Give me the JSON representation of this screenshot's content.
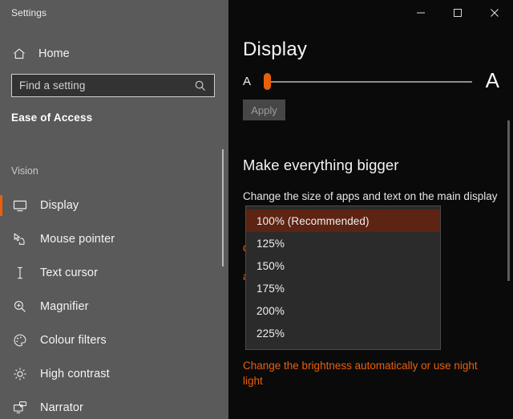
{
  "window": {
    "app_title": "Settings",
    "caption": {
      "minimize": "minimize-icon",
      "maximize": "maximize-icon",
      "close": "close-icon"
    }
  },
  "sidebar": {
    "home_label": "Home",
    "home_icon": "home-icon",
    "search": {
      "placeholder": "Find a setting",
      "value": "",
      "icon": "search-icon"
    },
    "section_title": "Ease of Access",
    "group_header": "Vision",
    "items": [
      {
        "label": "Display",
        "icon": "monitor-icon",
        "selected": true
      },
      {
        "label": "Mouse pointer",
        "icon": "pointer-hand-icon",
        "selected": false
      },
      {
        "label": "Text cursor",
        "icon": "text-cursor-icon",
        "selected": false
      },
      {
        "label": "Magnifier",
        "icon": "magnifier-plus-icon",
        "selected": false
      },
      {
        "label": "Colour filters",
        "icon": "palette-icon",
        "selected": false
      },
      {
        "label": "High contrast",
        "icon": "brightness-icon",
        "selected": false
      },
      {
        "label": "Narrator",
        "icon": "narrator-icon",
        "selected": false
      }
    ]
  },
  "main": {
    "page_title": "Display",
    "text_size_slider": {
      "small_label": "A",
      "large_label": "A",
      "value_percent": 3
    },
    "apply_label": "Apply",
    "bigger_heading": "Make everything bigger",
    "bigger_label": "Change the size of apps and text on the main display",
    "occluded_links": [
      "displays",
      "and mouse"
    ],
    "bottom_link": "Change the brightness automatically or use night light"
  },
  "dropdown": {
    "open": true,
    "selected": "100% (Recommended)",
    "options": [
      "100% (Recommended)",
      "125%",
      "150%",
      "175%",
      "200%",
      "225%"
    ]
  },
  "colors": {
    "accent": "#e8600c",
    "sidebar_bg": "#5a5a5a",
    "content_bg": "#0a0a0a",
    "dropdown_bg": "#2b2b2b",
    "dropdown_highlight": "#5d2313"
  }
}
